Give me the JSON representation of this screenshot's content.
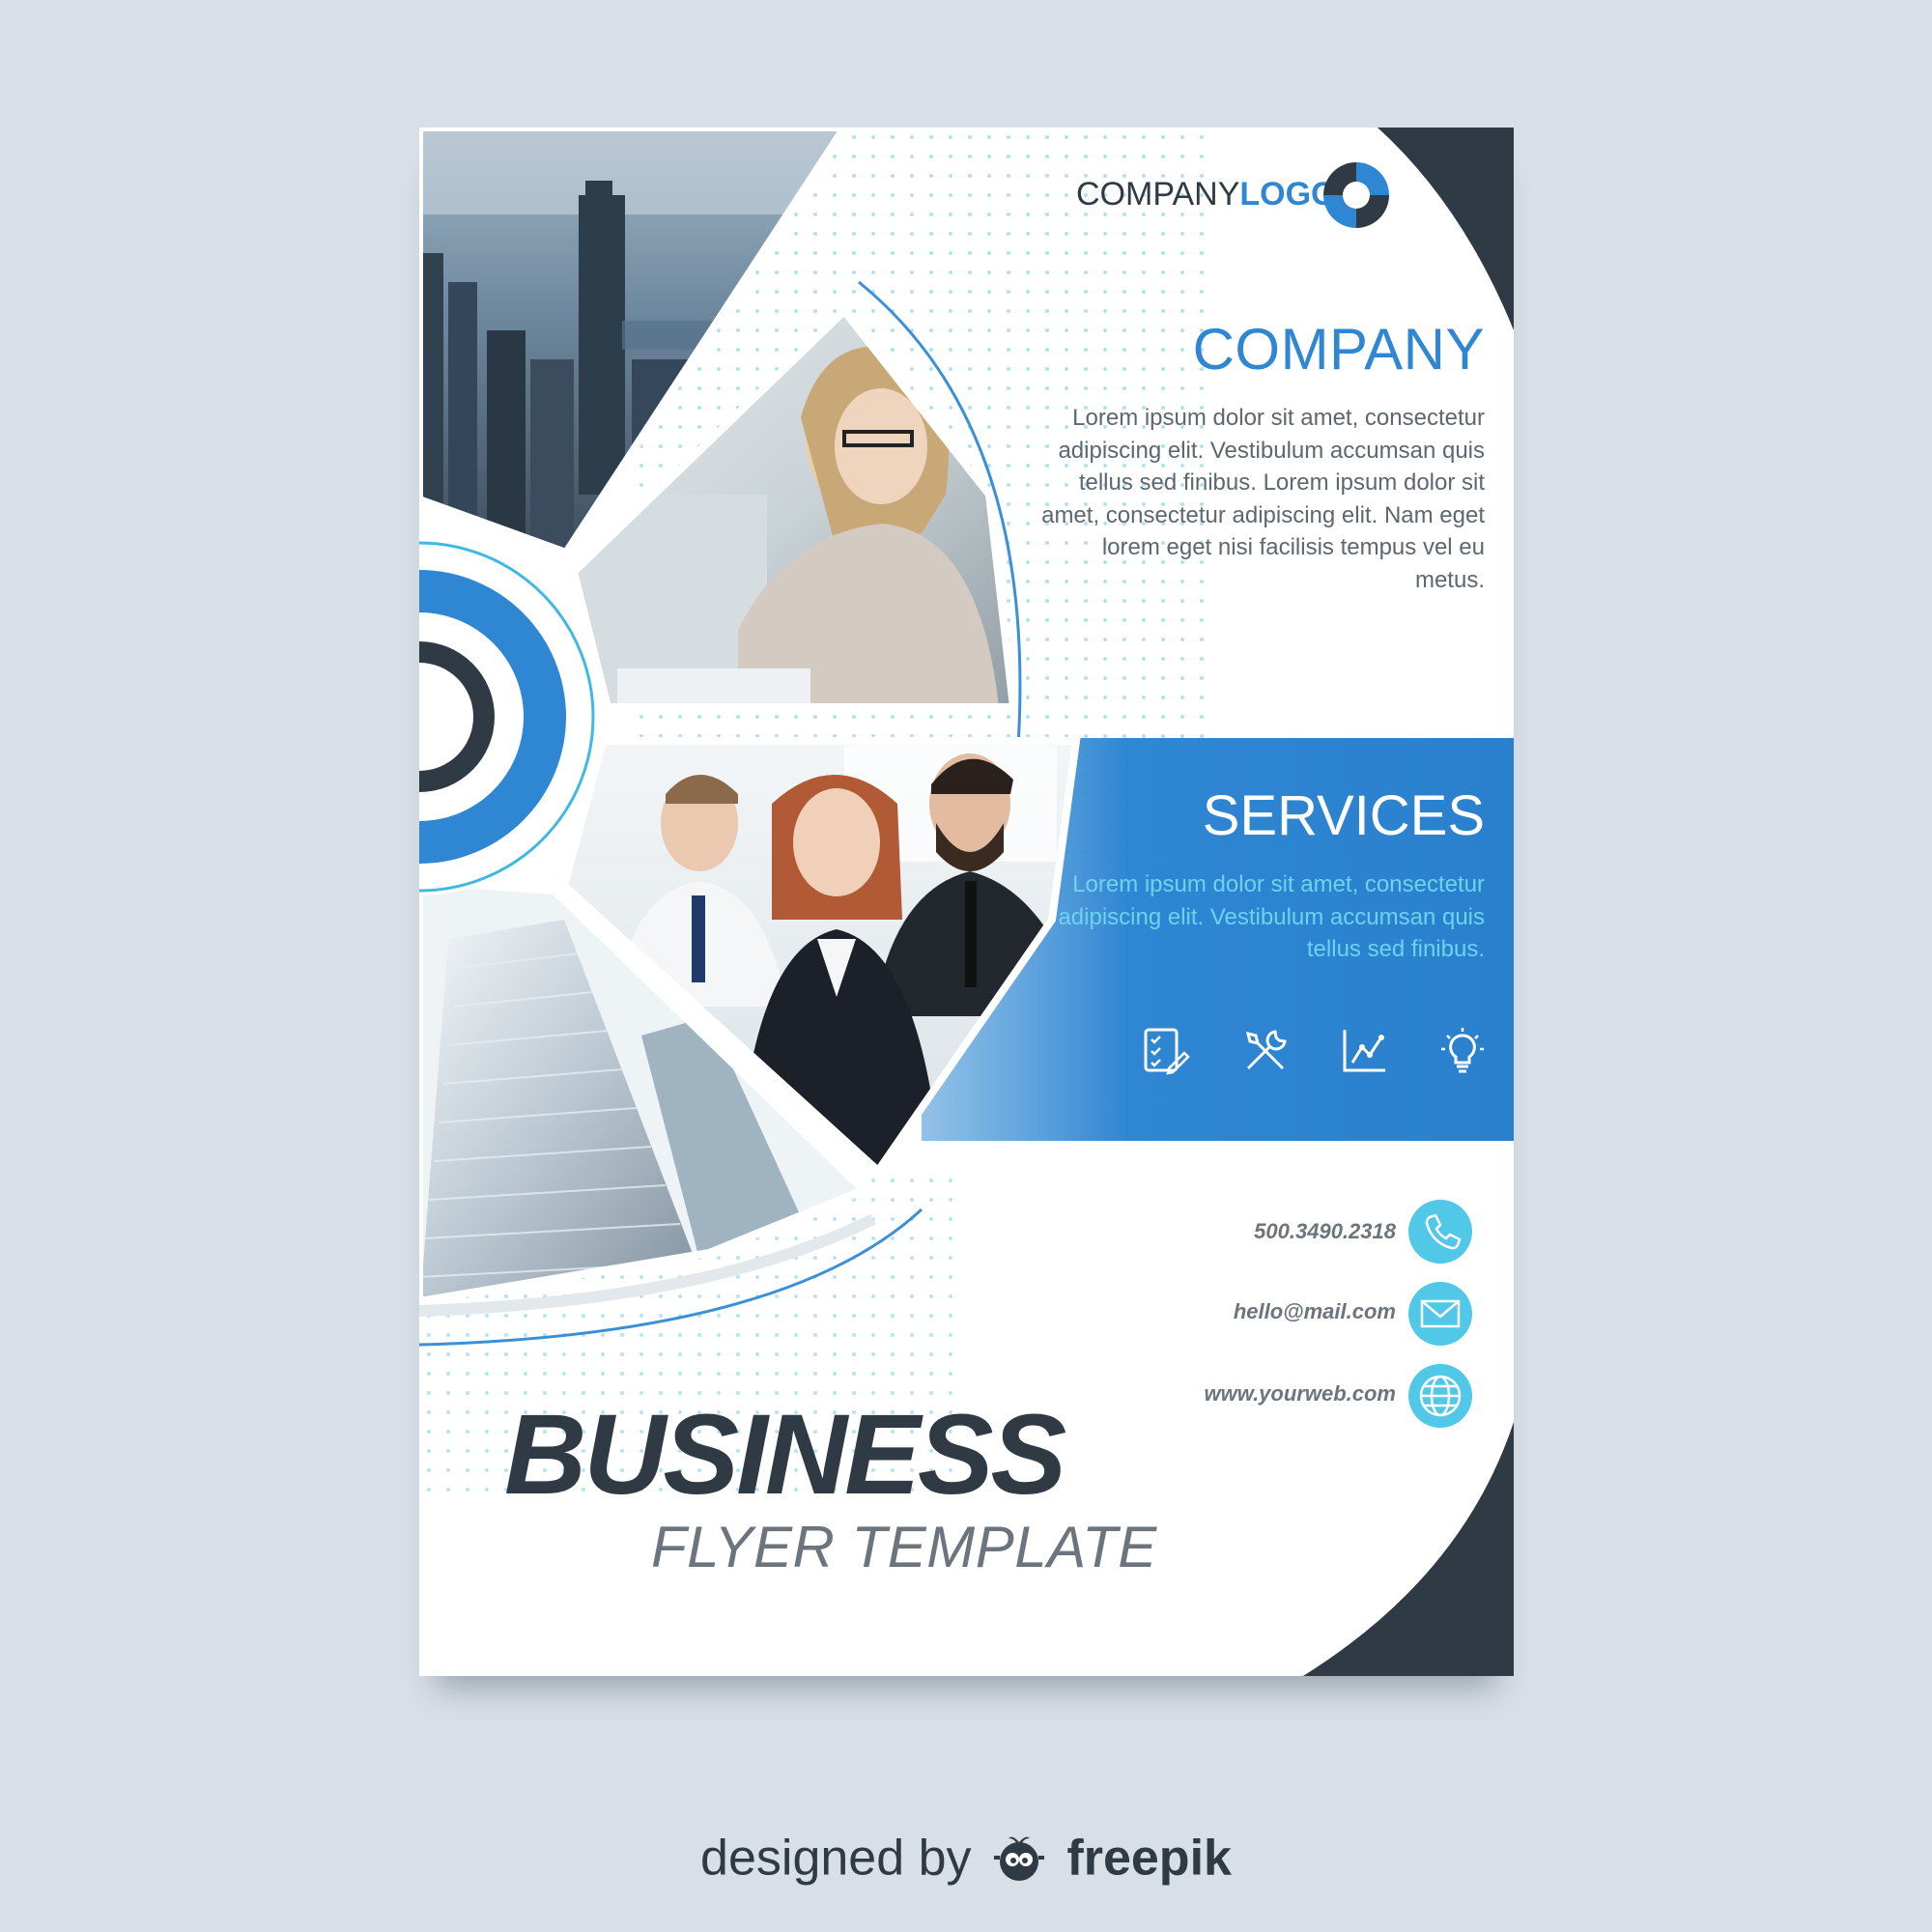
{
  "colors": {
    "accent": "#2f86d2",
    "accent_light": "#52c8e8",
    "dark": "#2f3a45",
    "muted_text": "#6c757d",
    "background": "#d8dfe6"
  },
  "logo": {
    "part1": "COMPANY",
    "part2": "LOGO"
  },
  "company": {
    "heading": "COMPANY",
    "body": "Lorem ipsum dolor sit amet, consectetur adipiscing elit. Vestibulum accumsan quis tellus sed finibus. Lorem ipsum dolor sit amet, consectetur adipiscing elit. Nam eget lorem eget nisi facilisis tempus vel eu metus."
  },
  "services": {
    "heading": "SERVICES",
    "body": "Lorem ipsum dolor sit amet, consectetur adipiscing elit. Vestibulum accumsan quis tellus sed finibus.",
    "icons": [
      "checklist-icon",
      "tools-icon",
      "chart-icon",
      "lightbulb-icon"
    ]
  },
  "contact": {
    "phone": "500.3490.2318",
    "email": "hello@mail.com",
    "website": "www.yourweb.com",
    "icons": [
      "phone-icon",
      "envelope-icon",
      "globe-icon"
    ]
  },
  "title": {
    "main": "BUSINESS",
    "sub": "FLYER TEMPLATE"
  },
  "photos": [
    "city-skyline-photo",
    "woman-at-laptop-photo",
    "business-team-photo",
    "office-building-photo"
  ],
  "credit": {
    "prefix": "designed by",
    "brand": "freepik"
  }
}
